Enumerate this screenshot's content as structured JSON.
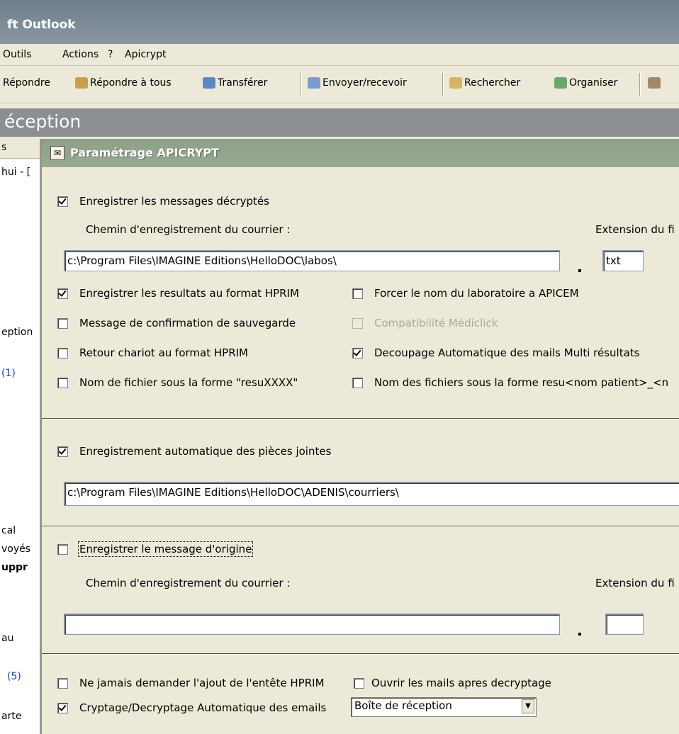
{
  "outlook": {
    "title": "ft Outlook",
    "menu": [
      "Outils",
      "Actions",
      "?",
      "Apicrypt"
    ],
    "toolbar": [
      "Répondre",
      "Répondre à tous",
      "Transférer",
      "Envoyer/recevoir",
      "Rechercher",
      "Organiser"
    ],
    "folder_title": "éception",
    "left_fragments": [
      "s",
      "hui - [",
      "eption",
      "(1)",
      "cal",
      "voyés",
      "uppr",
      "au",
      "(5)",
      "arte"
    ]
  },
  "dialog": {
    "title": "Paramétrage APICRYPT",
    "save_decrypted": {
      "label": "Enregistrer les messages décryptés",
      "checked": true
    },
    "path_label": "Chemin d'enregistrement du courrier :",
    "ext_label": "Extension du fi",
    "path_value": "c:\\Program Files\\IMAGINE Editions\\HelloDOC\\labos\\",
    "ext_value": "txt",
    "options": [
      {
        "label": "Enregistrer les resultats au format HPRIM",
        "checked": true
      },
      {
        "label": "Forcer le nom du laboratoire a APICEM",
        "checked": false
      },
      {
        "label": "Message de confirmation de sauvegarde",
        "checked": false
      },
      {
        "label": "Compatibilité Médiclick",
        "checked": false,
        "disabled": true
      },
      {
        "label": "Retour chariot au format HPRIM",
        "checked": false
      },
      {
        "label": "Decoupage Automatique des mails Multi résultats",
        "checked": true
      },
      {
        "label": "Nom de fichier sous la forme \"resuXXXX\"",
        "checked": false
      },
      {
        "label": "Nom des fichiers sous la forme resu<nom patient>_<n",
        "checked": false
      }
    ],
    "attachments": {
      "label": "Enregistrement automatique des pièces jointes",
      "checked": true
    },
    "attachments_path": "c:\\Program Files\\IMAGINE Editions\\HelloDOC\\ADENIS\\courriers\\",
    "original": {
      "label": "Enregistrer le message d'origine",
      "checked": false
    },
    "path_label2": "Chemin d'enregistrement du courrier :",
    "ext_label2": "Extension du fi",
    "path_value2": "",
    "ext_value2": "",
    "never_ask": {
      "label": "Ne jamais demander l'ajout de l'entête HPRIM",
      "checked": false
    },
    "open_after": {
      "label": "Ouvrir les mails apres decryptage",
      "checked": false
    },
    "auto_crypt": {
      "label": "Cryptage/Decryptage Automatique des emails",
      "checked": true
    },
    "folder_select": "Boîte de réception"
  },
  "colors": {
    "dialog_title": "#8ea08a",
    "window_bg": "#ece9d8",
    "folder_bar": "#8b8f92"
  }
}
